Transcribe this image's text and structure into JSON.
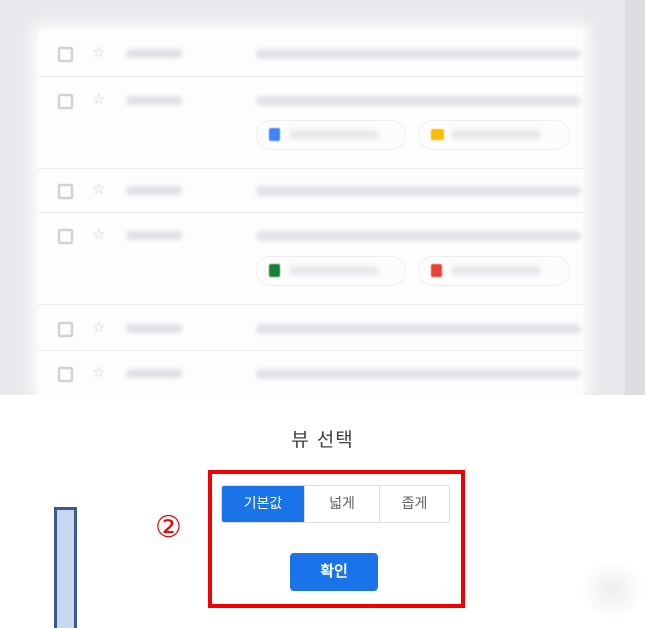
{
  "dialog": {
    "title": "뷰 선택",
    "options": [
      {
        "label": "기본값",
        "selected": true
      },
      {
        "label": "넓게",
        "selected": false
      },
      {
        "label": "좁게",
        "selected": false
      }
    ],
    "confirm_label": "확인"
  },
  "annotation": {
    "marker": "②",
    "highlight_color": "#f20000"
  },
  "preview": {
    "rows": 6,
    "attachment_icons": [
      "doc-icon",
      "slides-icon",
      "sheets-icon",
      "image-icon"
    ]
  },
  "colors": {
    "accent": "#1a73e8",
    "doc": "#4285f4",
    "slides": "#fbbc04",
    "sheets": "#188038",
    "image": "#ea4335"
  }
}
